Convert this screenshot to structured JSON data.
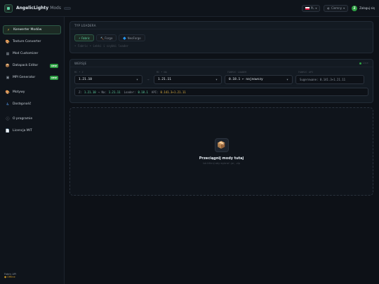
{
  "header": {
    "brand": "AngelicLighty",
    "brand_sub": "Mods",
    "version": "",
    "language": "PL",
    "theme": "Ciemny",
    "user_initial": "Z",
    "user_label": "Zaloguj się"
  },
  "sidebar": {
    "section_tools": "",
    "section_visual": "",
    "section_info": "",
    "items": [
      {
        "label": "Konwerter Modów",
        "icon": "lightning-icon"
      },
      {
        "label": "Texture Converter",
        "icon": "palette-icon"
      },
      {
        "label": "Mod Customizer",
        "icon": "grid-icon"
      },
      {
        "label": "Datapack Editor",
        "icon": "package-icon",
        "badge": "NEW"
      },
      {
        "label": "MPI Generator",
        "icon": "chip-icon",
        "badge": "NEW"
      },
      {
        "label": "Motywy",
        "icon": "palette-icon"
      },
      {
        "label": "Dostępność",
        "icon": "accessibility-icon"
      },
      {
        "label": "O programie",
        "icon": "info-icon"
      },
      {
        "label": "Licencja MIT",
        "icon": "document-icon"
      }
    ],
    "footer_label": "Fabric API",
    "footer_status": "● Offline"
  },
  "loader": {
    "title": "TYP LOADERA",
    "tabs": [
      {
        "label": "⚡ Fabric"
      },
      {
        "label": "🔨 Forge"
      },
      {
        "label": "🔷 NeoForge"
      }
    ],
    "hint": "• Fabric • Lekki i szybki loader"
  },
  "versions": {
    "title": "WERSJE",
    "live": "Live",
    "from_label": "MC • Z",
    "to_label": "MC • NA",
    "loader_label": "FABRIC LOADER",
    "api_label": "FABRIC API",
    "from_value": "1.21.10",
    "to_value": "1.21.11",
    "loader_value": "0.18.1 ← najnowszy",
    "api_value": "Sugerowane: 0.141.3+1.21.11",
    "summary": {
      "z_label": "Z:",
      "z_val": "1.21.10",
      "na_label": "→ Na:",
      "na_val": "1.21.11",
      "loader_label": "Loader:",
      "loader_val": "0.18.1",
      "api_label": "API:",
      "api_val": "0.141.3+1.21.11"
    }
  },
  "drop": {
    "title": "Przeciągnij mody tutaj",
    "subtitle": "lub kliknij aby wybrać .jar, .zip"
  }
}
